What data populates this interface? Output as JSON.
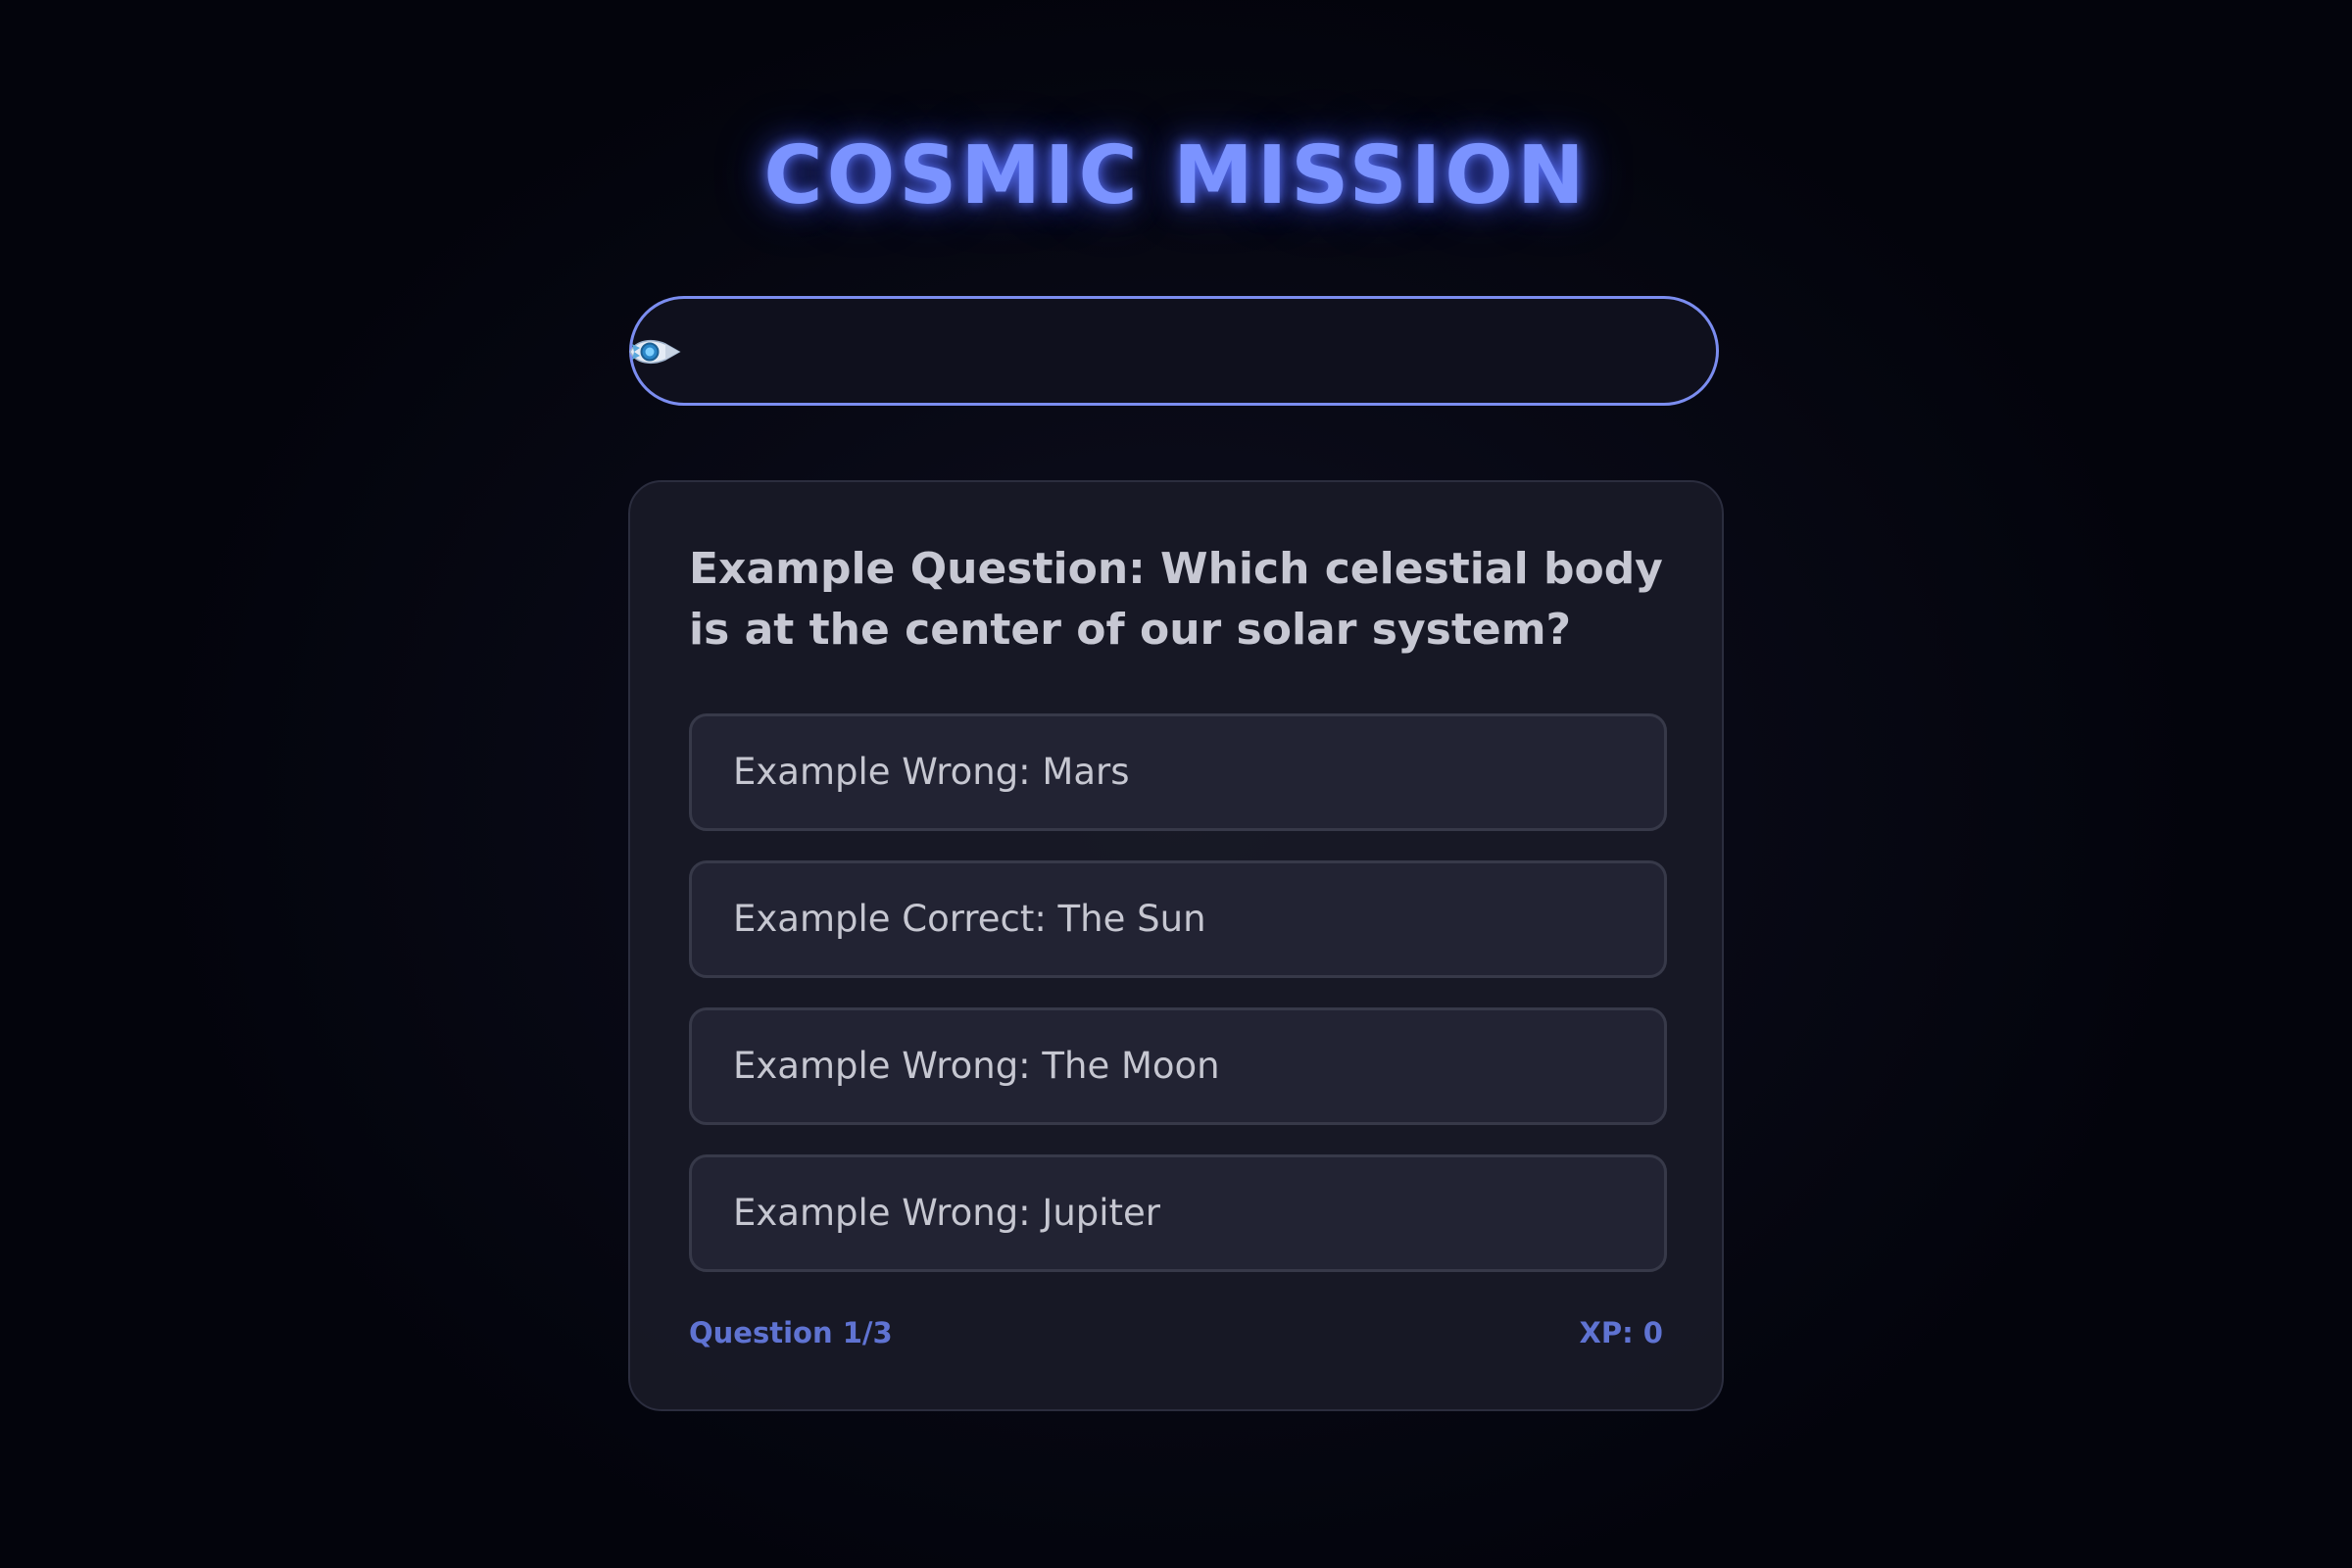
{
  "title": "COSMIC MISSION",
  "progress": {
    "fraction": 0,
    "icon": "rocket-icon"
  },
  "quiz": {
    "question": "Example Question: Which celestial body is at the center of our solar system?",
    "options": [
      {
        "label": "Example Wrong: Mars"
      },
      {
        "label": "Example Correct: The Sun"
      },
      {
        "label": "Example Wrong: The Moon"
      },
      {
        "label": "Example Wrong: Jupiter"
      }
    ],
    "question_counter": "Question 1/3",
    "xp": "XP: 0"
  },
  "colors": {
    "accent": "#7b93ff",
    "track_border": "#7b8df0",
    "footer_text": "#5f73d2",
    "card_bg": "#181926",
    "option_bg": "#222333"
  }
}
